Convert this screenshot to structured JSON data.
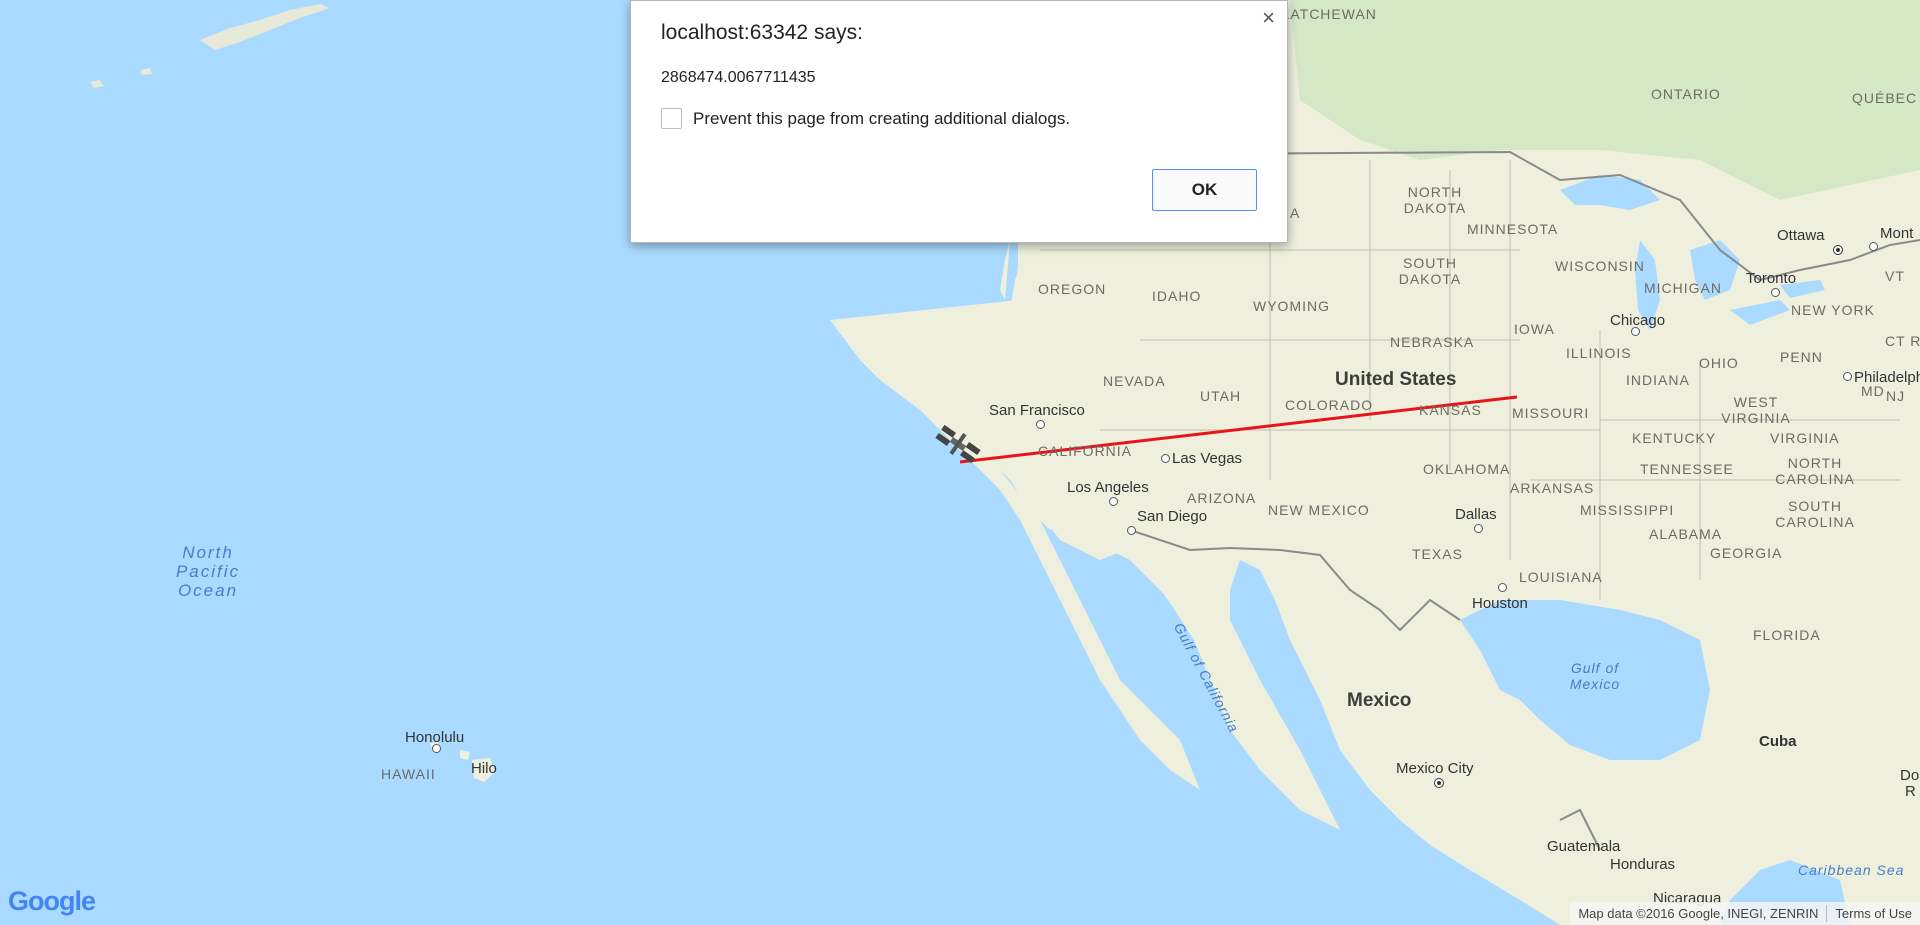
{
  "dialog": {
    "title": "localhost:63342 says:",
    "message": "2868474.0067711435",
    "checkbox_label": "Prevent this page from creating additional dialogs.",
    "ok_label": "OK",
    "close_symbol": "×"
  },
  "map": {
    "states": [
      "KATCHEWAN",
      "NORTH DAKOTA",
      "MINNESOTA",
      "WISCONSIN",
      "MICHIGAN",
      "SOUTH DAKOTA",
      "IOWA",
      "ILLINOIS",
      "INDIANA",
      "OHIO",
      "OREGON",
      "IDAHO",
      "WYOMING",
      "NEBRASKA",
      "NEVADA",
      "UTAH",
      "COLORADO",
      "KANSAS",
      "MISSOURI",
      "CALIFORNIA",
      "ARIZONA",
      "NEW MEXICO",
      "OKLAHOMA",
      "ARKANSAS",
      "TEXAS",
      "LOUISIANA",
      "MISSISSIPPI",
      "ALABAMA",
      "GEORGIA",
      "TENNESSEE",
      "KENTUCKY",
      "WEST VIRGINIA",
      "VIRGINIA",
      "NORTH CAROLINA",
      "SOUTH CAROLINA",
      "FLORIDA",
      "PENN",
      "NEW YORK",
      "VT",
      "CT RI",
      "MD",
      "NJ",
      "ONTARIO",
      "QUÉBEC",
      "HAWAII",
      "A"
    ],
    "countries": [
      "United States",
      "Mexico",
      "Cuba"
    ],
    "cities": [
      "San Francisco",
      "Las Vegas",
      "Los Angeles",
      "San Diego",
      "Dallas",
      "Houston",
      "Chicago",
      "Toronto",
      "Ottawa",
      "Mont",
      "Philadelph",
      "Mexico City",
      "Guatemala",
      "Honduras",
      "Nicaragua",
      "Honolulu",
      "Hilo",
      "Do",
      "R"
    ],
    "water": [
      "Gulf of California",
      "Gulf of Mexico",
      "Caribbean Sea"
    ],
    "ocean": "North Pacific Ocean",
    "route_color": "#e8141c",
    "marker_icon": "satellite-icon"
  },
  "footer": {
    "logo": "Google",
    "map_data": "Map data ©2016 Google, INEGI, ZENRIN",
    "terms": "Terms of Use"
  }
}
